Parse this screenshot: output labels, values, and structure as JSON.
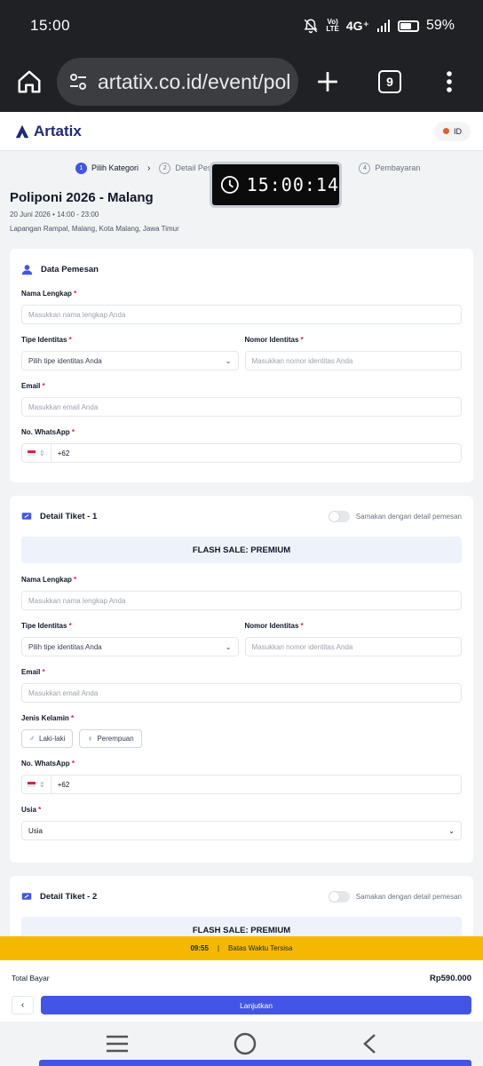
{
  "status_bar": {
    "time": "15:00",
    "volte_top": "Vo)",
    "volte_bottom": "LTE",
    "network": "4G⁺",
    "battery": "59%"
  },
  "browser": {
    "url": "artatix.co.id/event/pol",
    "tab_count": "9"
  },
  "header": {
    "logo": "Artatix",
    "lang": "ID"
  },
  "steps": [
    {
      "num": "1",
      "label": "Pilih Kategori"
    },
    {
      "num": "2",
      "label": "Detail Pes"
    },
    {
      "num": "4",
      "label": "Pembayaran"
    }
  ],
  "overlay_timer": "15:00:14",
  "event": {
    "title": "Poliponi 2026 - Malang",
    "date": "20 Juni 2026  •  14:00 - 23:00",
    "location": "Lapangan Rampal, Malang, Kota Malang, Jawa Timur"
  },
  "labels": {
    "required": "*",
    "full_name": "Nama Lengkap",
    "id_type": "Tipe Identitas",
    "id_number": "Nomor Identitas",
    "email": "Email",
    "whatsapp": "No. WhatsApp",
    "gender": "Jenis Kelamin",
    "age": "Usia"
  },
  "placeholders": {
    "full_name": "Masukkan nama lengkap Anda",
    "id_type": "Pilih tipe identitas Anda",
    "id_number": "Masukkan nomor identitas Anda",
    "email": "Masukkan email Anda",
    "phone_code": "+62",
    "age": "Usia"
  },
  "booker": {
    "title": "Data Pemesan"
  },
  "ticket1": {
    "title": "Detail Tiket - 1",
    "same_toggle": "Samakan dengan detail pemesan",
    "category": "FLASH SALE: PREMIUM",
    "gender_male": "Laki-laki",
    "gender_female": "Perempuan"
  },
  "ticket2": {
    "title": "Detail Tiket - 2",
    "same_toggle": "Samakan dengan detail pemesan",
    "category": "FLASH SALE: PREMIUM"
  },
  "countdown": {
    "time": "09:55",
    "label": "Batas Waktu Tersisa"
  },
  "footer": {
    "total_label": "Total Bayar",
    "total_value": "Rp590.000",
    "back": "‹",
    "next": "Lanjutkan"
  },
  "colors": {
    "primary": "#4355e6",
    "warning": "#f5b800",
    "required": "#e11d48"
  }
}
